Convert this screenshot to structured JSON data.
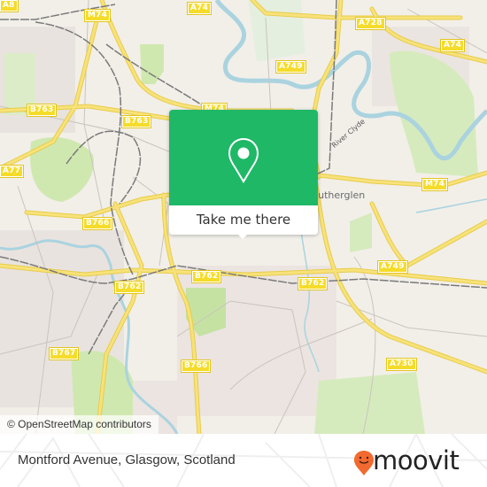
{
  "map": {
    "attribution": "© OpenStreetMap contributors",
    "road_labels": [
      "M74",
      "A74",
      "A728",
      "A74",
      "A749",
      "B763",
      "B763",
      "M74",
      "A77",
      "M74",
      "B766",
      "B762",
      "B762",
      "B762",
      "A749",
      "B767",
      "B766",
      "A730",
      "A8"
    ],
    "place_labels": [
      "Rutherglen"
    ],
    "water_labels": [
      "River Clyde"
    ],
    "colors": {
      "land": "#f2efe9",
      "park": "#cfe8b0",
      "water": "#aad3df",
      "road_major": "#f7e27a",
      "road_casing": "#e8cc4a",
      "rail": "#777777",
      "residential": "#e8e0dc"
    }
  },
  "popup": {
    "icon": "location-pin-icon",
    "button_label": "Take me there",
    "accent_color": "#1fb866"
  },
  "footer": {
    "address": "Montford Avenue, Glasgow, Scotland",
    "brand": "moovit",
    "brand_icon": "moovit-smiley-pin-icon",
    "brand_color": "#f26a30"
  }
}
